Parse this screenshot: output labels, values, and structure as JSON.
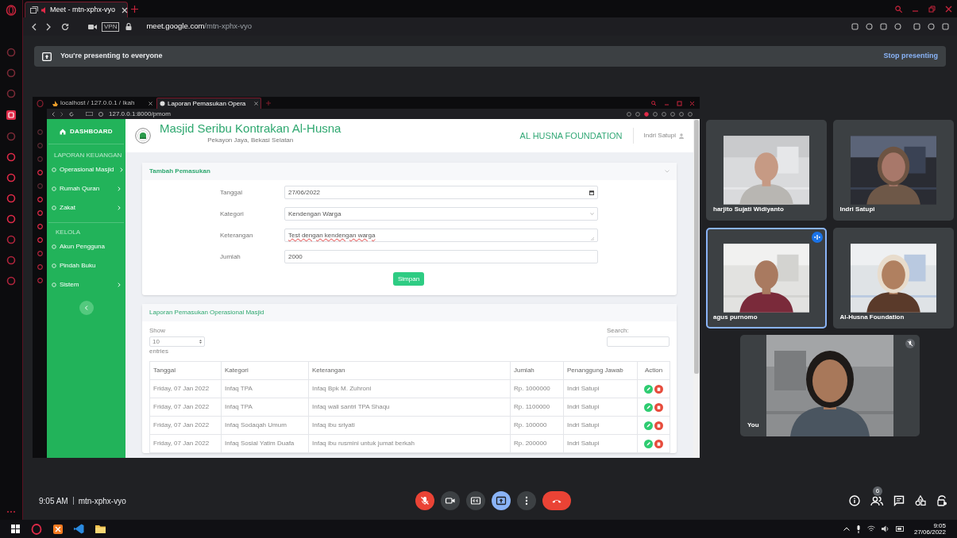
{
  "browser": {
    "tab_title": "Meet - mtn-xphx-vyo",
    "url_host": "meet.google.com",
    "url_path": "/mtn-xphx-vyo",
    "vpn_badge": "VPN"
  },
  "banner": {
    "text": "You're presenting to everyone",
    "action": "Stop presenting"
  },
  "shared_screen": {
    "tabs": [
      {
        "title": "localhost / 127.0.0.1 / Ikah",
        "selected": false
      },
      {
        "title": "Laporan Pemasukan Opera",
        "selected": true
      }
    ],
    "url": "127.0.0.1:8000/pmom",
    "sidebar": {
      "brand": "DASHBOARD",
      "sections": [
        {
          "heading": "LAPORAN KEUANGAN",
          "items": [
            {
              "label": "Operasional Masjid",
              "submenu": true
            },
            {
              "label": "Rumah Quran",
              "submenu": true
            },
            {
              "label": "Zakat",
              "submenu": true
            }
          ]
        },
        {
          "heading": "KELOLA",
          "items": [
            {
              "label": "Akun Pengguna",
              "submenu": false
            },
            {
              "label": "Pindah Buku",
              "submenu": false
            },
            {
              "label": "Sistem",
              "submenu": true
            }
          ]
        }
      ]
    },
    "header": {
      "title": "Masjid Seribu Kontrakan Al-Husna",
      "subtitle": "Pekayon Jaya, Bekasi Selatan",
      "organization": "AL HUSNA FOUNDATION",
      "user": "Indri Satupi"
    },
    "form": {
      "title": "Tambah Pemasukan",
      "fields": [
        {
          "label": "Tanggal",
          "kind": "date",
          "value": "27/06/2022"
        },
        {
          "label": "Kategori",
          "kind": "select",
          "value": "Kendengan Warga"
        },
        {
          "label": "Keterangan",
          "kind": "textarea",
          "value": "Test dengan kendengan warga"
        },
        {
          "label": "Jumlah",
          "kind": "text",
          "value": "2000"
        }
      ],
      "submit": "Simpan"
    },
    "report": {
      "title": "Laporan Pemasukan Operasional Masjid",
      "show_label": "Show",
      "page_size": "10",
      "entries_label": "entries",
      "search_label": "Search:",
      "columns": [
        "Tanggal",
        "Kategori",
        "Keterangan",
        "Jumlah",
        "Penanggung Jawab",
        "Action"
      ],
      "rows": [
        [
          "Friday, 07 Jan 2022",
          "Infaq TPA",
          "Infaq Bpk M. Zuhroni",
          "Rp. 1000000",
          "Indri Satupi"
        ],
        [
          "Friday, 07 Jan 2022",
          "Infaq TPA",
          "Infaq wali santri TPA Shaqu",
          "Rp. 1100000",
          "Indri Satupi"
        ],
        [
          "Friday, 07 Jan 2022",
          "Infaq Sodaqah Umum",
          "Infaq ibu sriyati",
          "Rp. 100000",
          "Indri Satupi"
        ],
        [
          "Friday, 07 Jan 2022",
          "Infaq Sosial Yatim Duafa",
          "Infaq ibu rusmini untuk jumat berkah",
          "Rp. 200000",
          "Indri Satupi"
        ]
      ]
    }
  },
  "participants": [
    {
      "name": "harjito Sujati Widiyanto",
      "speaking": false,
      "muted": false
    },
    {
      "name": "Indri Satupi",
      "speaking": false,
      "muted": false
    },
    {
      "name": "agus purnomo",
      "speaking": true,
      "muted": false
    },
    {
      "name": "Al-Husna Foundation",
      "speaking": false,
      "muted": false
    },
    {
      "name": "You",
      "speaking": false,
      "muted": true
    }
  ],
  "meeting": {
    "time": "9:05 AM",
    "code": "mtn-xphx-vyo",
    "people_count": "6",
    "controls": [
      {
        "kind": "mic",
        "on": false
      },
      {
        "kind": "camera",
        "on": true
      },
      {
        "kind": "captions",
        "on": false
      },
      {
        "kind": "present",
        "on": true
      },
      {
        "kind": "more"
      },
      {
        "kind": "hangup"
      }
    ]
  },
  "taskbar": {
    "time": "9:05",
    "date": "27/06/2022"
  }
}
